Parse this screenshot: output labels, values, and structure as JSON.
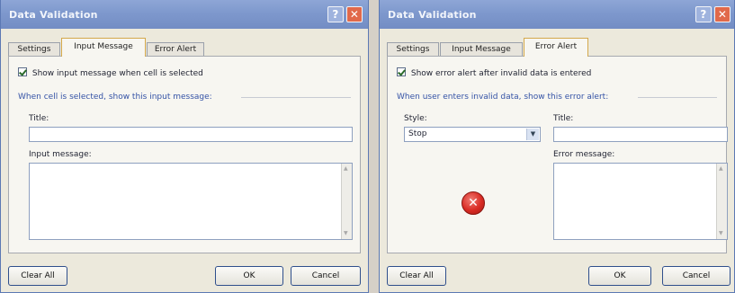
{
  "left_dialog": {
    "title": "Data Validation",
    "help_glyph": "?",
    "close_glyph": "✕",
    "tabs": [
      {
        "label": "Settings",
        "active": false
      },
      {
        "label": "Input Message",
        "active": true
      },
      {
        "label": "Error Alert",
        "active": false
      }
    ],
    "checkbox_label": "Show input message when cell is selected",
    "checkbox_checked": true,
    "group_label": "When cell is selected, show this input message:",
    "title_label": "Title:",
    "title_value": "",
    "message_label": "Input message:",
    "message_value": "",
    "buttons": {
      "clear_all": "Clear All",
      "ok": "OK",
      "cancel": "Cancel"
    }
  },
  "right_dialog": {
    "title": "Data Validation",
    "help_glyph": "?",
    "close_glyph": "✕",
    "tabs": [
      {
        "label": "Settings",
        "active": false
      },
      {
        "label": "Input Message",
        "active": false
      },
      {
        "label": "Error Alert",
        "active": true
      }
    ],
    "checkbox_label": "Show error alert after invalid data is entered",
    "checkbox_checked": true,
    "group_label": "When user enters invalid data, show this error alert:",
    "style_label": "Style:",
    "style_value": "Stop",
    "dropdown_glyph": "▼",
    "stop_icon_glyph": "✕",
    "title_label": "Title:",
    "title_value": "",
    "message_label": "Error message:",
    "message_value": "",
    "buttons": {
      "clear_all": "Clear All",
      "ok": "OK",
      "cancel": "Cancel"
    }
  },
  "icons": {
    "help": "question-mark",
    "close": "x-mark",
    "stop": "red-circle-x",
    "dropdown": "chevron-down",
    "scroll_up": "arrow-up",
    "scroll_down": "arrow-down"
  },
  "colors": {
    "titlebar": "#7e98cd",
    "close_button": "#e1694a",
    "stop_icon": "#d92b24",
    "group_label": "#3553a6",
    "active_tab_border": "#d4a84b"
  }
}
